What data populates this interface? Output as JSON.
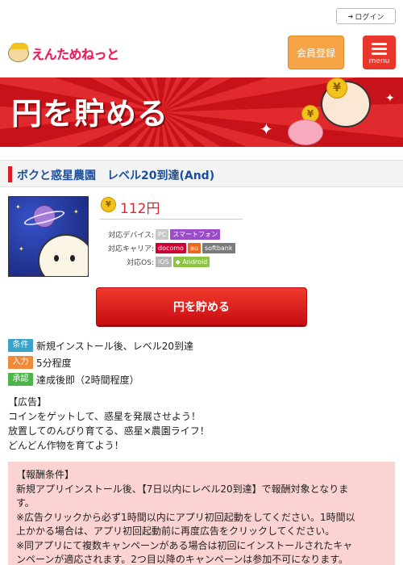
{
  "header": {
    "login_label": "ログイン",
    "logo_text": "えんためねっと",
    "member_label": "会員登録",
    "menu_label": "menu"
  },
  "banner": {
    "title": "円を貯める"
  },
  "app": {
    "title": "ボクと惑星農園　レベル20到達(And)",
    "price": "112円",
    "specs": [
      {
        "label": "対応デバイス:",
        "tags": [
          "PC",
          "スマートフォン"
        ]
      },
      {
        "label": "対応キャリア:",
        "tags": [
          "docomo",
          "au",
          "softbank"
        ]
      },
      {
        "label": "対応OS:",
        "tags": [
          "iOS",
          "Android"
        ]
      }
    ],
    "action_label": "円を貯める"
  },
  "conditions": [
    {
      "tag": "条件",
      "text": "新規インストール後、レベル20到達",
      "color": "#3ba2c8"
    },
    {
      "tag": "入力",
      "text": "5分程度",
      "color": "#ee8a3a"
    },
    {
      "tag": "承認",
      "text": "達成後即（2時間程度）",
      "color": "#4cb54a"
    }
  ],
  "description": [
    "【広告】",
    "コインをゲットして、惑星を発展させよう！",
    "放置してのんびり育てる、惑星×農園ライフ！",
    "どんどん作物を育てよう！"
  ],
  "reward": [
    "【報酬条件】",
    "新規アプリインストール後、【7日以内にレベル20到達】で報酬対象となりま",
    "す。",
    "※広告クリックから必ず1時間以内にアプリ初回起動をしてください。1時間以",
    "上かかる場合は、アプリ初回起動前に再度広告をクリックしてください。",
    "※同アプリにて複数キャンペーンがある場合は初回にインストールされたキャ",
    "ンペーンが適応されます。2つ目以降のキャンペーンは参加不可になります。"
  ],
  "colors": {
    "accent_red": "#d81c2a",
    "title_blue": "#1a4fa0",
    "member_orange": "#f7a446",
    "reward_bg": "#fcd3d3"
  }
}
